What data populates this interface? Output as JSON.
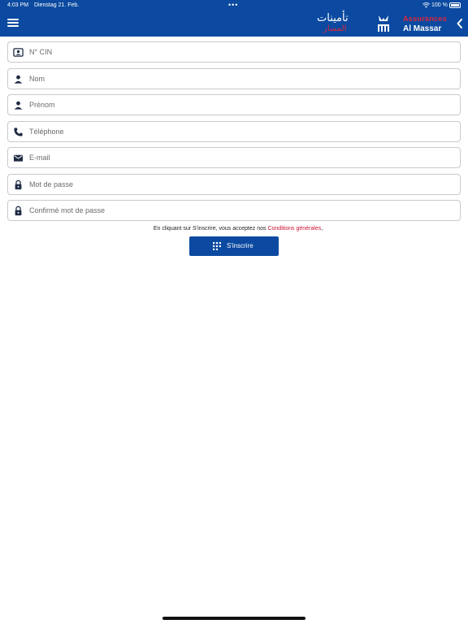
{
  "status_bar": {
    "time": "4:03 PM",
    "date": "Dienstag 21. Feb.",
    "battery": "100 %"
  },
  "header": {
    "logo_arabic_line1": "تأمينات",
    "logo_arabic_line2": "المسار",
    "logo_line1": "Assurances",
    "logo_line2": "Al Massar",
    "brand_color": "#0b4aa0",
    "accent_color": "#e0253a"
  },
  "form": {
    "fields": [
      {
        "placeholder": "N° CIN",
        "icon": "id-card-icon"
      },
      {
        "placeholder": "Nom",
        "icon": "person-icon"
      },
      {
        "placeholder": "Prénom",
        "icon": "person-icon"
      },
      {
        "placeholder": "Téléphone",
        "icon": "phone-icon"
      },
      {
        "placeholder": "E-mail",
        "icon": "mail-icon"
      },
      {
        "placeholder": "Mot de passe",
        "icon": "lock-icon"
      },
      {
        "placeholder": "Confirmé mot de passe",
        "icon": "lock-icon"
      }
    ],
    "terms_text": "En cliquant sur S'inscrire, vous acceptez nos ",
    "terms_link": "Conditions générales",
    "terms_suffix": ",",
    "submit_label": "S'inscrire"
  }
}
